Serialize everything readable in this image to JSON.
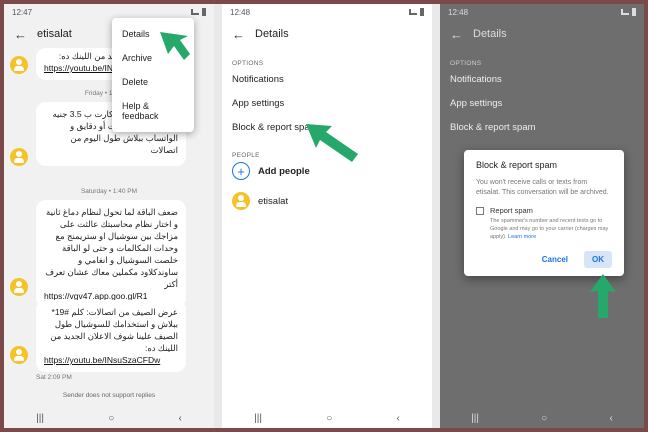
{
  "panel1": {
    "time": "12:47",
    "title": "etisalat",
    "menu": [
      "Details",
      "Archive",
      "Delete",
      "Help & feedback"
    ],
    "messages": [
      {
        "text": "شوف الاعلان الجديد من اللينك ده:",
        "link": "https://youtu.be/INs",
        "stamp": ""
      },
      {
        "text": "اليوم اشحن فوري كارت ب 3.5 جنيه أو 1.5 جنيه ميكسات أو دقايق و الواتساب ببلاش طول اليوم من اتصالات",
        "link": "",
        "stamp": ""
      },
      {
        "text": "ضعف الباقة لما تحول لنظام دماغ ثانية و اختار نظام محاسبتك عالثت على مزاجك بين سوشيال او ستريمنج مع وحدات المكالمات و حتى لو الباقة خلصت السوشيال و انغامي و ساوندكلاود مكملين معاك عشان تعرف أكتر",
        "link": "https://vgv47.app.goo.gl/R1",
        "stamp": ""
      },
      {
        "text": "عرض الصيف من اتصالات: كلم #19* ببلاش و استخدامك للسوشيال طول الصيف علينا شوف الاعلان الجديد من اللينك ده:",
        "link": "https://youtu.be/INsuSzaCFDw",
        "stamp": "Sat 2:09 PM"
      }
    ],
    "separators": [
      "Friday • 1:28 PM",
      "Saturday • 1:40 PM"
    ],
    "footer": "Sender does not support replies"
  },
  "panel2": {
    "time": "12:48",
    "title": "Details",
    "options_header": "OPTIONS",
    "options": [
      "Notifications",
      "App settings",
      "Block & report spam"
    ],
    "people_header": "PEOPLE",
    "add_people": "Add people",
    "person": "etisalat"
  },
  "panel3": {
    "time": "12:48",
    "title": "Details",
    "options_header": "OPTIONS",
    "options": [
      "Notifications",
      "App settings",
      "Block & report spam"
    ],
    "dialog": {
      "title": "Block & report spam",
      "body": "You won't receive calls or texts from etisalat. This conversation will be archived.",
      "checkbox_label": "Report spam",
      "checkbox_sub": "The spammer's number and recent texts go to Google and may go to your carrier (charges may apply).",
      "learn_more": "Learn more",
      "cancel": "Cancel",
      "ok": "OK"
    }
  },
  "nav": {
    "recents": "|||",
    "home": "○",
    "back": "‹"
  },
  "colors": {
    "accent": "#1a73e8",
    "arrow": "#26a86a",
    "avatar": "#f4c32a"
  }
}
